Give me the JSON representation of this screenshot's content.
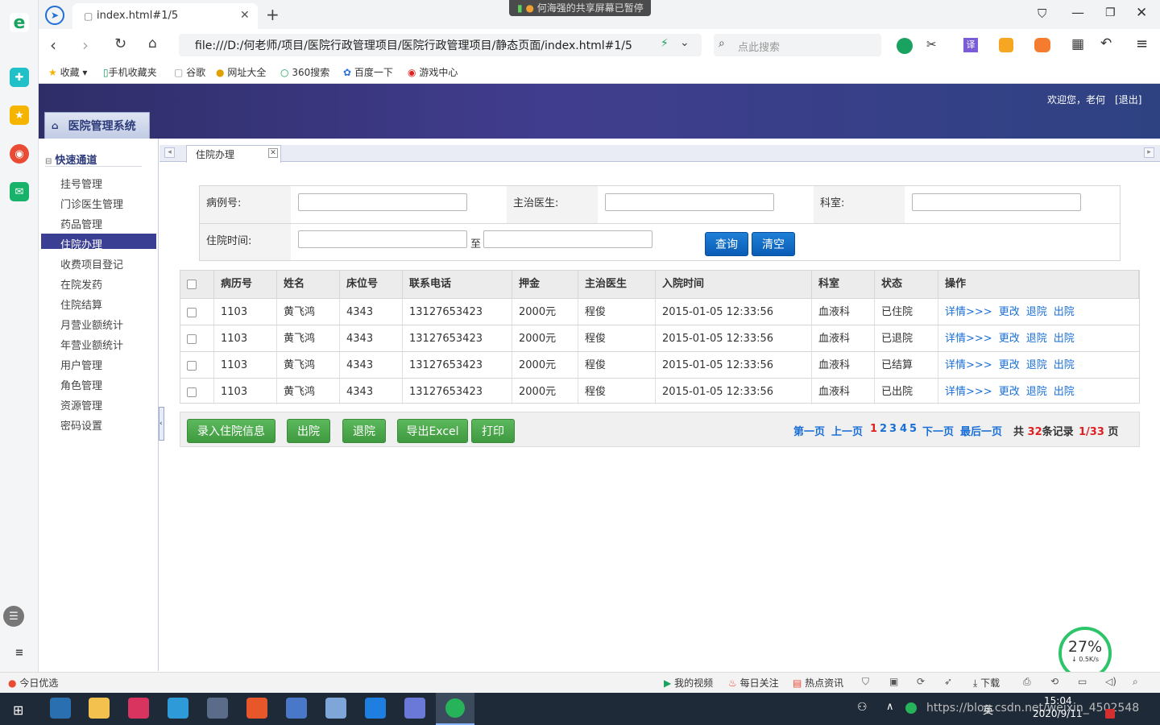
{
  "browser": {
    "tab_title": "index.html#1/5",
    "share_banner": "何海强的共享屏幕已暂停",
    "address": "file:///D:/何老师/项目/医院行政管理项目/医院行政管理项目/静态页面/index.html#1/5",
    "search_placeholder": "点此搜索",
    "bookmarks": [
      "收藏",
      "手机收藏夹",
      "谷歌",
      "网址大全",
      "360搜索",
      "百度一下",
      "游戏中心"
    ]
  },
  "app": {
    "welcome": "欢迎您，老何",
    "logout": "[退出]",
    "title": "医院管理系统",
    "menu_title": "快速通道",
    "menu": [
      "挂号管理",
      "门诊医生管理",
      "药品管理",
      "住院办理",
      "收费项目登记",
      "在院发药",
      "住院结算",
      "月营业额统计",
      "年营业额统计",
      "用户管理",
      "角色管理",
      "资源管理",
      "密码设置"
    ],
    "active_menu": "住院办理",
    "content_tab": "住院办理"
  },
  "form": {
    "case_no_label": "病例号:",
    "doctor_label": "主治医生:",
    "dept_label": "科室:",
    "time_label": "住院时间:",
    "to_label": "至",
    "query_btn": "查询",
    "clear_btn": "清空"
  },
  "table": {
    "headers": [
      "病历号",
      "姓名",
      "床位号",
      "联系电话",
      "押金",
      "主治医生",
      "入院时间",
      "科室",
      "状态",
      "操作"
    ],
    "rows": [
      [
        "1103",
        "黄飞鸿",
        "4343",
        "13127653423",
        "2000元",
        "程俊",
        "2015-01-05 12:33:56",
        "血液科",
        "已住院"
      ],
      [
        "1103",
        "黄飞鸿",
        "4343",
        "13127653423",
        "2000元",
        "程俊",
        "2015-01-05 12:33:56",
        "血液科",
        "已退院"
      ],
      [
        "1103",
        "黄飞鸿",
        "4343",
        "13127653423",
        "2000元",
        "程俊",
        "2015-01-05 12:33:56",
        "血液科",
        "已结算"
      ],
      [
        "1103",
        "黄飞鸿",
        "4343",
        "13127653423",
        "2000元",
        "程俊",
        "2015-01-05 12:33:56",
        "血液科",
        "已出院"
      ]
    ],
    "actions": [
      "详情>>>",
      "更改",
      "退院",
      "出院"
    ]
  },
  "toolbar": {
    "buttons": [
      "录入住院信息",
      "出院",
      "退院",
      "导出Excel",
      "打印"
    ],
    "first": "第一页",
    "prev": "上一页",
    "pages": [
      "1",
      "2",
      "3",
      "4",
      "5"
    ],
    "next": "下一页",
    "last": "最后一页",
    "total_pre": "共",
    "total_count": "32",
    "total_suf": "条记录",
    "page_cur": "1/33",
    "page_suf": "页"
  },
  "status": {
    "left": "今日优选",
    "items": [
      "我的视频",
      "每日关注",
      "热点资讯",
      "下载"
    ],
    "speed_percent": "27%",
    "speed_rate": "↓ 0.5K/s"
  },
  "taskbar": {
    "time": "15:04",
    "date": "2020/9/11",
    "ime": "英",
    "watermark": "https://blog.csdn.net/weixin_4502548"
  },
  "colors": {
    "header": "#3a387f",
    "active_menu": "#3b3f94",
    "link": "#1a6fd6",
    "green_btn": "#4cae4c",
    "blue_btn": "#0f6bc6"
  }
}
